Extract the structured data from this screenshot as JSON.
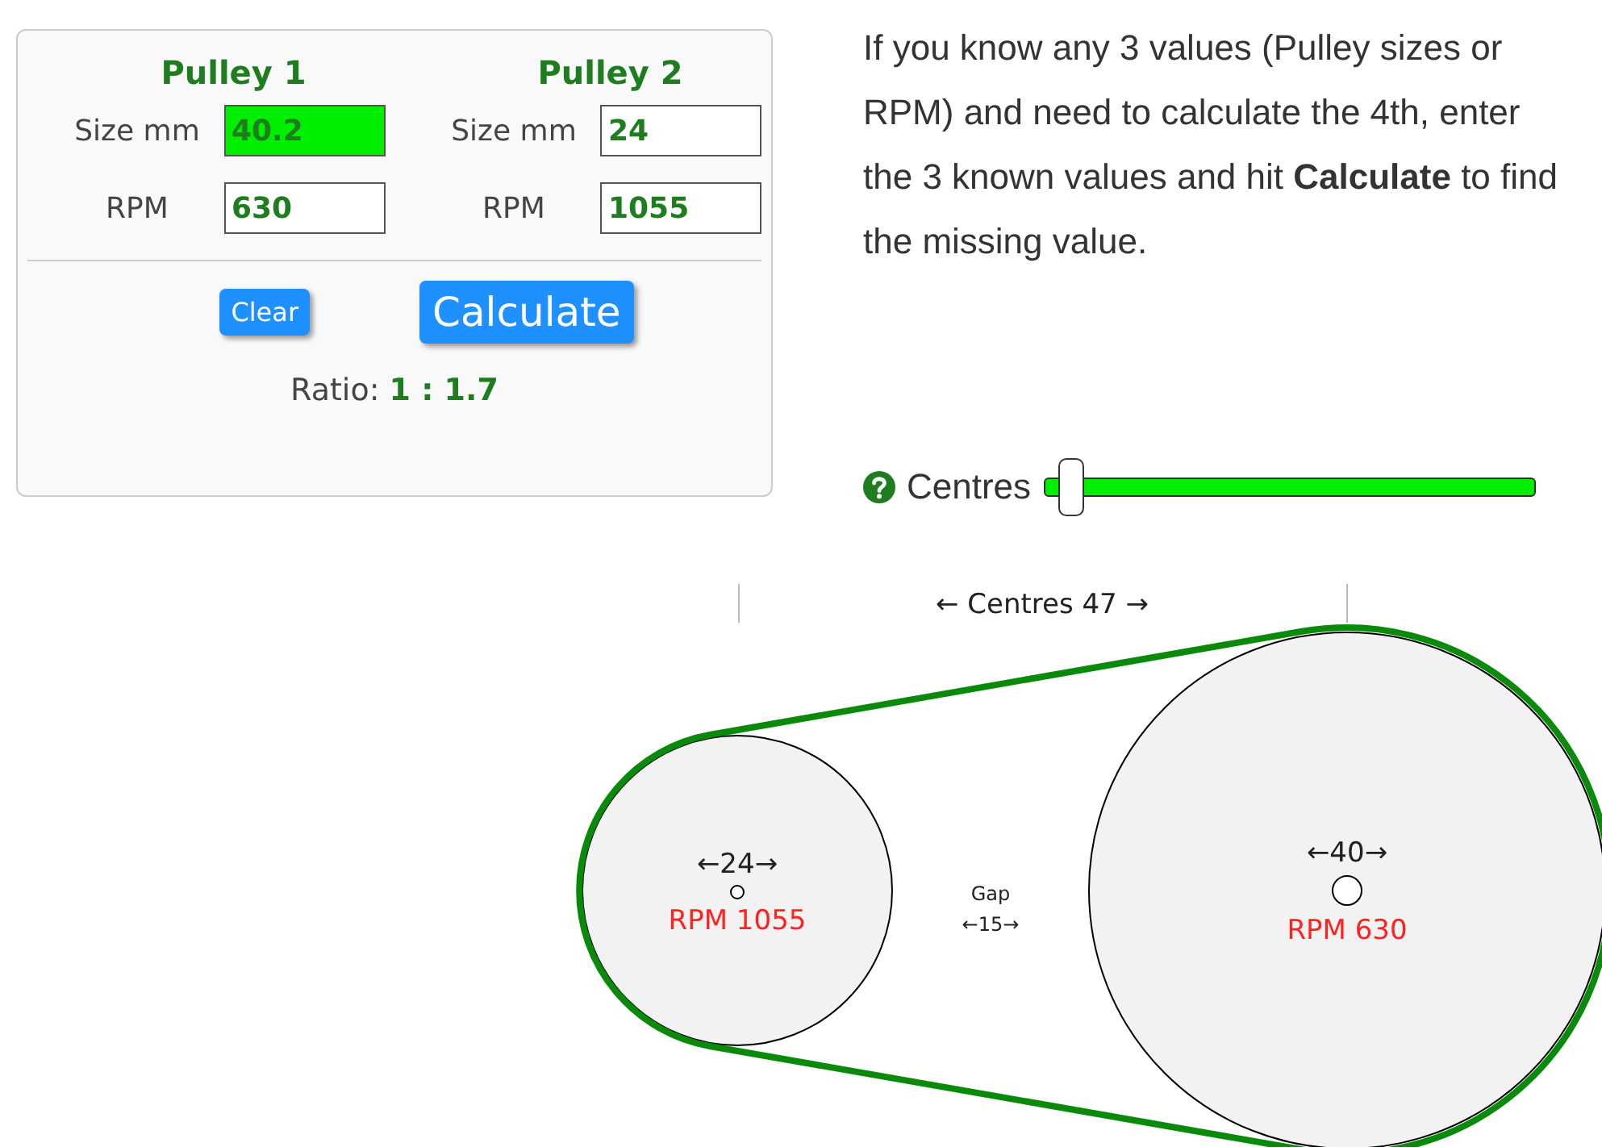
{
  "pulleys": [
    {
      "title": "Pulley 1",
      "size_label": "Size mm",
      "size": "40.2",
      "size_highlighted": true,
      "rpm_label": "RPM",
      "rpm": "630"
    },
    {
      "title": "Pulley 2",
      "size_label": "Size mm",
      "size": "24",
      "size_highlighted": false,
      "rpm_label": "RPM",
      "rpm": "1055"
    }
  ],
  "buttons": [
    {
      "label": "Clear",
      "kind": "small"
    },
    {
      "label": "Calculate",
      "kind": "large"
    }
  ],
  "ratio": {
    "label": "Ratio:",
    "value": "1 : 1.7"
  },
  "instructions": "If you know any 3 values (Pulley sizes or RPM) and need to calculate the 4th, enter the 3 known values and hit **Calculate** to find the missing value.",
  "slider": {
    "label": "Centres",
    "level": 0.06
  },
  "diagram": {
    "centres": "← Centres 47 →",
    "gap_label": "Gap",
    "gap": "←15→",
    "small": {
      "dimension": "←24→",
      "rpm": "RPM 1055"
    },
    "large": {
      "dimension": "←40→",
      "rpm": "RPM 630"
    }
  }
}
